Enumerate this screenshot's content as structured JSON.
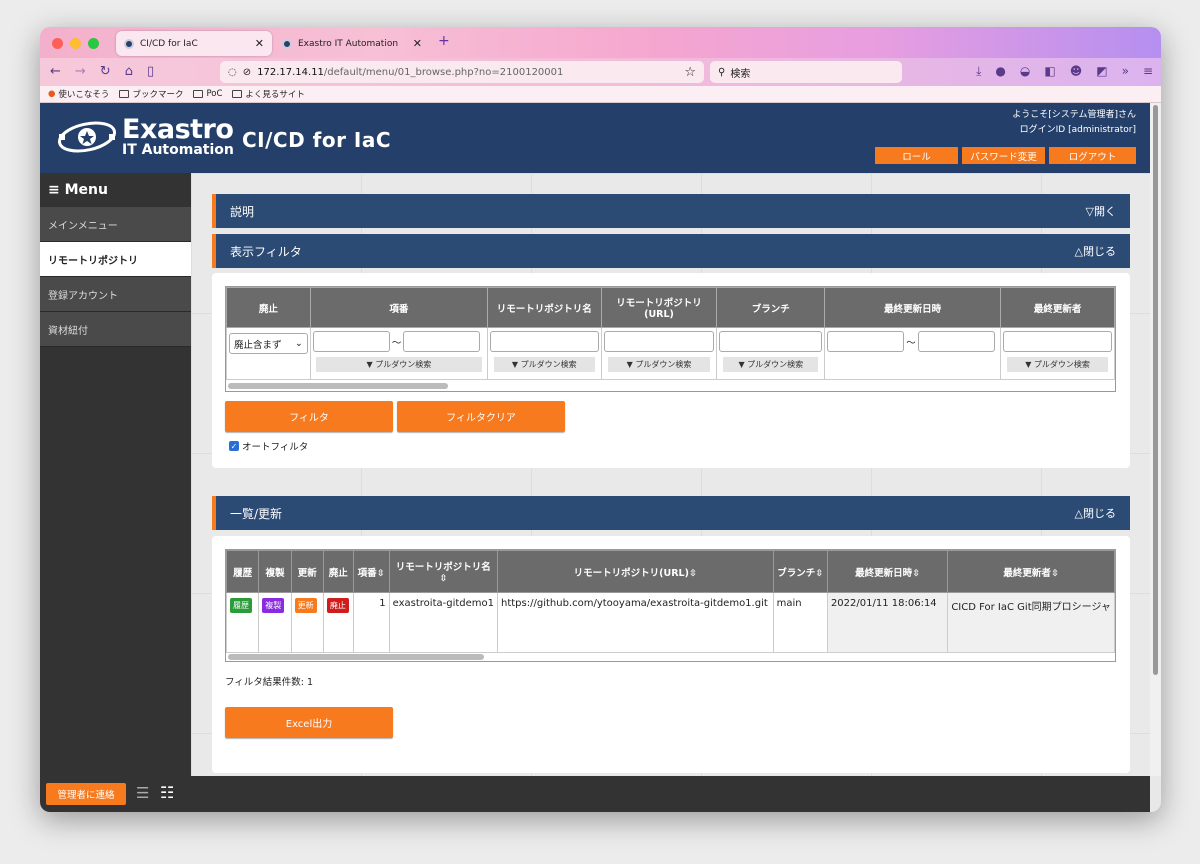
{
  "browser": {
    "tabs": [
      {
        "label": "CI/CD for IaC",
        "active": true
      },
      {
        "label": "Exastro IT Automation",
        "active": false
      }
    ],
    "url_host": "172.17.14.11",
    "url_path": "/default/menu/01_browse.php?no=2100120001",
    "search_placeholder": "検索",
    "bookmarks": [
      "使いこなそう",
      "ブックマーク",
      "PoC",
      "よく見るサイト"
    ]
  },
  "header": {
    "logo_line1": "Exastro",
    "logo_line2": "IT Automation",
    "title": "CI/CD for IaC",
    "welcome": "ようこそ[システム管理者]さん",
    "login_id": "ログインID [administrator]",
    "buttons": {
      "role": "ロール",
      "password": "パスワード変更",
      "logout": "ログアウト"
    }
  },
  "sidebar": {
    "menu_label": "≡ Menu",
    "items": [
      "メインメニュー",
      "リモートリポジトリ",
      "登録アカウント",
      "資材紐付"
    ]
  },
  "sections": {
    "description": {
      "label": "説明",
      "toggle": "▽開く"
    },
    "filter": {
      "label": "表示フィルタ",
      "toggle": "△閉じる"
    },
    "list": {
      "label": "一覧/更新",
      "toggle": "△閉じる"
    }
  },
  "filter": {
    "headers": [
      "廃止",
      "項番",
      "リモートリポジトリ名",
      "リモートリポジトリ(URL)",
      "ブランチ",
      "最終更新日時",
      "最終更新者"
    ],
    "select_value": "廃止含まず",
    "tilde": "～",
    "pulldown": "▼ プルダウン検索",
    "filter_button": "フィルタ",
    "clear_button": "フィルタクリア",
    "autofilter_label": "オートフィルタ"
  },
  "list": {
    "headers": [
      "履歴",
      "複製",
      "更新",
      "廃止",
      "項番",
      "リモートリポジトリ名",
      "リモートリポジトリ(URL)",
      "ブランチ",
      "最終更新日時",
      "最終更新者"
    ],
    "row_buttons": {
      "history": "履歴",
      "copy": "複製",
      "update": "更新",
      "discard": "廃止"
    },
    "row": {
      "no": "1",
      "name": "exastroita-gitdemo1",
      "url": "https://github.com/ytooyama/exastroita-gitdemo1.git",
      "branch": "main",
      "updated_at": "2022/01/11 18:06:14",
      "updated_by": "CICD For IaC Git同期プロシージャ"
    },
    "result_count": "フィルタ結果件数: 1",
    "excel_button": "Excel出力"
  },
  "footer": {
    "contact": "管理者に連絡"
  },
  "colors": {
    "accent": "#f77a1e",
    "header": "#24406a",
    "section": "#2b4a74",
    "sidebar": "#333333"
  }
}
